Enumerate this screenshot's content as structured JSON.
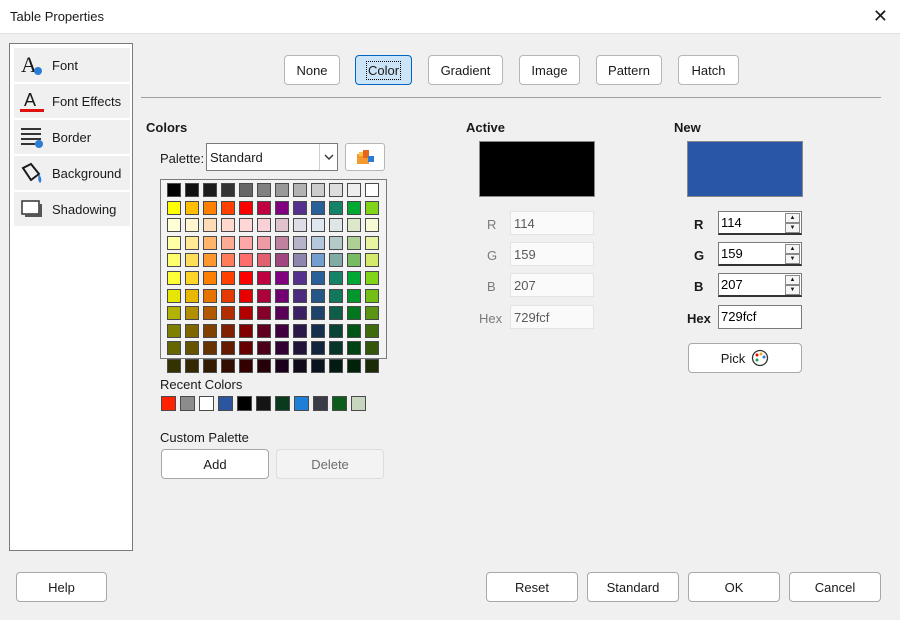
{
  "window": {
    "title": "Table Properties",
    "close": "✕"
  },
  "sidebar": {
    "items": [
      {
        "label": "Font",
        "icon": "font-icon"
      },
      {
        "label": "Font Effects",
        "icon": "font-effects-icon"
      },
      {
        "label": "Border",
        "icon": "border-icon"
      },
      {
        "label": "Background",
        "icon": "background-icon"
      },
      {
        "label": "Shadowing",
        "icon": "shadowing-icon"
      }
    ]
  },
  "tabs": [
    "None",
    "Color",
    "Gradient",
    "Image",
    "Pattern",
    "Hatch"
  ],
  "active_tab": "Color",
  "colors": {
    "heading": "Colors",
    "palette_label": "Palette:",
    "palette_value": "Standard",
    "grid": [
      [
        "#000000",
        "#111111",
        "#1c1c1c",
        "#333333",
        "#666666",
        "#808080",
        "#999999",
        "#b2b2b2",
        "#cccccc",
        "#dddddd",
        "#eeeeee",
        "#ffffff"
      ],
      [
        "#ffff00",
        "#ffbf00",
        "#ff8000",
        "#ff4000",
        "#ff0000",
        "#bf0041",
        "#800080",
        "#55308d",
        "#2a6099",
        "#158466",
        "#00a933",
        "#81d41a"
      ],
      [
        "#ffffd7",
        "#fff5ce",
        "#ffdbb6",
        "#ffd8ce",
        "#ffd7d7",
        "#f7d1d5",
        "#e0c2cd",
        "#dedce6",
        "#dee6ef",
        "#dee7e5",
        "#dde8cb",
        "#f6f9d4"
      ],
      [
        "#ffffa6",
        "#ffe994",
        "#ffb66c",
        "#ffaa95",
        "#ffa6a6",
        "#ec9ba4",
        "#bf819e",
        "#b7b3ca",
        "#b4c7dc",
        "#b3cac7",
        "#afd095",
        "#e8f2a1"
      ],
      [
        "#ffff6d",
        "#ffde59",
        "#ff972f",
        "#ff7b59",
        "#ff6d6d",
        "#e16173",
        "#a1467e",
        "#8e86ae",
        "#729fcf",
        "#81aca6",
        "#77bc65",
        "#d4ea6b"
      ],
      [
        "#ffff38",
        "#ffd428",
        "#ff8000",
        "#ff4000",
        "#ff0000",
        "#bf0041",
        "#800080",
        "#55308d",
        "#2a6099",
        "#158466",
        "#00a933",
        "#81d41a"
      ],
      [
        "#e6e600",
        "#e6b800",
        "#e67300",
        "#e63900",
        "#e60000",
        "#ac003a",
        "#730073",
        "#4c2b7f",
        "#265689",
        "#13775c",
        "#00982e",
        "#74bf17"
      ],
      [
        "#b2b200",
        "#b28f00",
        "#b25900",
        "#b22d00",
        "#b20000",
        "#860029",
        "#590059",
        "#3b2163",
        "#1d436a",
        "#0f5c47",
        "#00761f",
        "#5a9412"
      ],
      [
        "#808000",
        "#806600",
        "#804000",
        "#802000",
        "#800000",
        "#600020",
        "#400040",
        "#2a1849",
        "#15304c",
        "#0a4233",
        "#005416",
        "#406b0d"
      ],
      [
        "#666600",
        "#665200",
        "#663300",
        "#661a00",
        "#660000",
        "#4d001a",
        "#330033",
        "#22133a",
        "#11263d",
        "#083529",
        "#004312",
        "#33560a"
      ],
      [
        "#333300",
        "#332900",
        "#331a00",
        "#330d00",
        "#330000",
        "#260008",
        "#1a001a",
        "#110a1d",
        "#08131e",
        "#041b14",
        "#002209",
        "#1a2b05"
      ]
    ],
    "recent_label": "Recent Colors",
    "recent": [
      "#ff2200",
      "#8c8c8c",
      "#ffffff",
      "#2a56a0",
      "#000000",
      "#141414",
      "#0a3a1e",
      "#1f7fd6",
      "#3b3b48",
      "#0c5c1c",
      "#c8d6c0"
    ],
    "custom_palette_label": "Custom Palette",
    "add_label": "Add",
    "delete_label": "Delete"
  },
  "active": {
    "heading": "Active",
    "color": "#000000",
    "r_label": "R",
    "r": "114",
    "g_label": "G",
    "g": "159",
    "b_label": "B",
    "b": "207",
    "hex_label": "Hex",
    "hex": "729fcf"
  },
  "new_color": {
    "heading": "New",
    "color": "#2a56a8",
    "r_label": "R",
    "r": "114",
    "g_label": "G",
    "g": "159",
    "b_label": "B",
    "b": "207",
    "hex_label": "Hex",
    "hex": "729fcf",
    "pick_label": "Pick"
  },
  "footer": {
    "help": "Help",
    "reset": "Reset",
    "standard": "Standard",
    "ok": "OK",
    "cancel": "Cancel"
  }
}
